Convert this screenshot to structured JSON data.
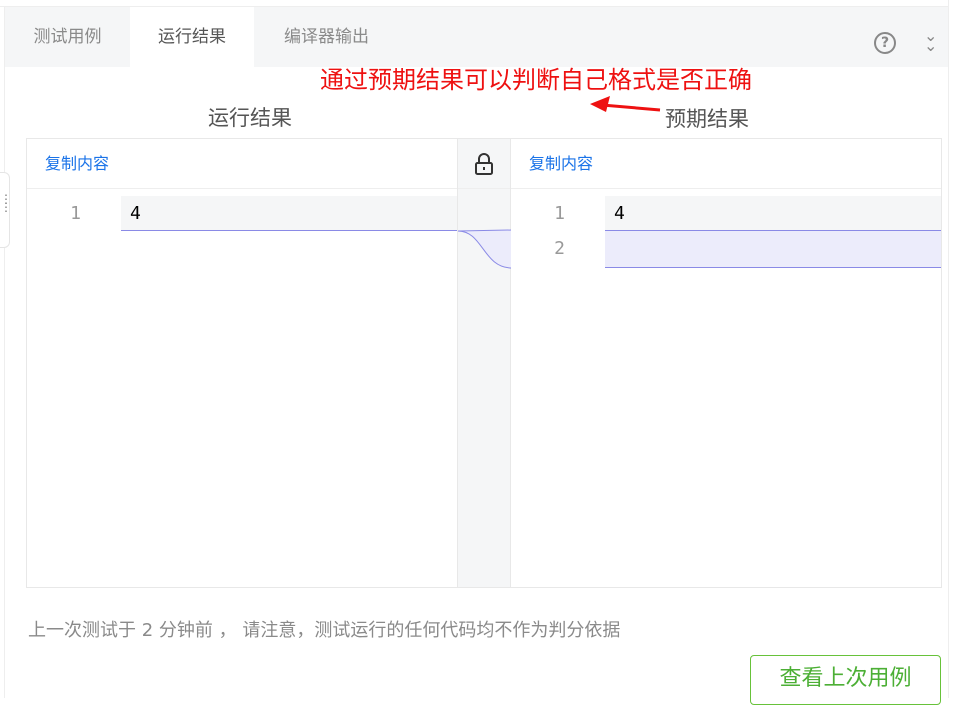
{
  "tabs": [
    {
      "label": "测试用例"
    },
    {
      "label": "运行结果",
      "active": true
    },
    {
      "label": "编译器输出"
    }
  ],
  "icons": {
    "help": "?",
    "collapse": "»"
  },
  "annotation": {
    "text": "通过预期结果可以判断自己格式是否正确",
    "color": "#ee1111"
  },
  "diff": {
    "left_title": "运行结果",
    "right_title": "预期结果",
    "copy_label": "复制内容",
    "left_lines": [
      {
        "num": "1",
        "text": "4"
      }
    ],
    "right_lines": [
      {
        "num": "1",
        "text": "4"
      },
      {
        "num": "2",
        "text": ""
      }
    ]
  },
  "footer": {
    "text": "上一次测试于 2 分钟前 ，  请注意，测试运行的任何代码均不作为判分依据"
  },
  "button": {
    "label": "查看上次用例"
  }
}
